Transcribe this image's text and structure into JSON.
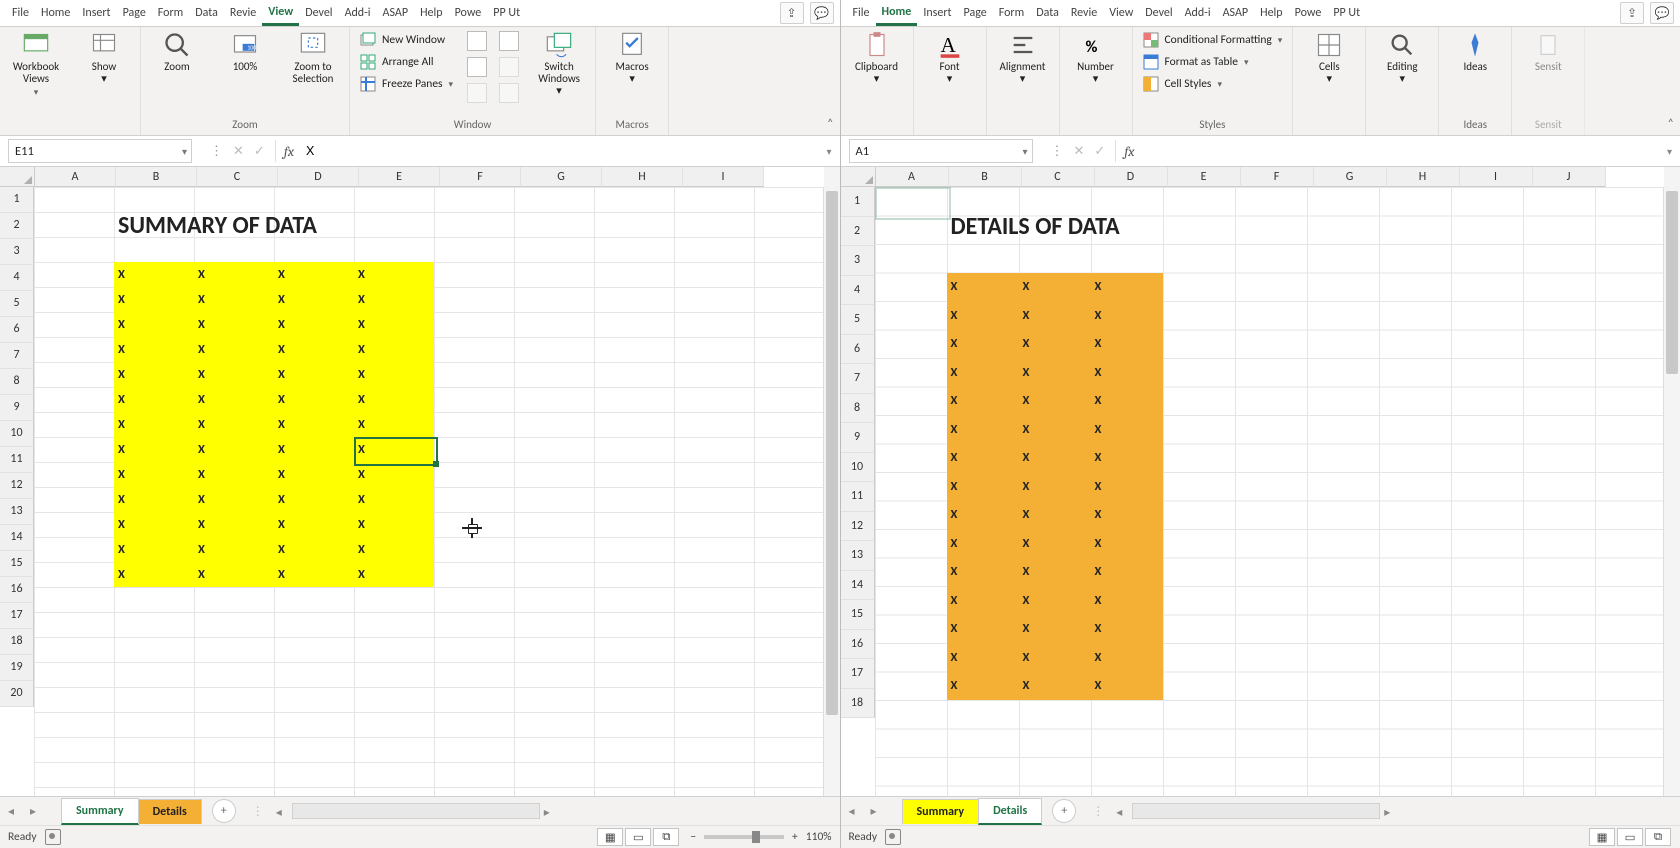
{
  "left": {
    "tabs": [
      "File",
      "Home",
      "Insert",
      "Page",
      "Form",
      "Data",
      "Revie",
      "View",
      "Devel",
      "Add-i",
      "ASAP",
      "Help",
      "Powe",
      "PP Ut"
    ],
    "active_tab": "View",
    "ribbon": {
      "workbook_views": "Workbook\nViews",
      "show": "Show",
      "zoom": "Zoom",
      "hundred": "100%",
      "zoom_sel": "Zoom to\nSelection",
      "zoom_group": "Zoom",
      "new_window": "New Window",
      "arrange_all": "Arrange All",
      "freeze_panes": "Freeze Panes",
      "switch_windows": "Switch\nWindows",
      "macros": "Macros",
      "window_group": "Window",
      "macros_group": "Macros"
    },
    "namebox": "E11",
    "formula": "X",
    "columns": [
      "A",
      "B",
      "C",
      "D",
      "E",
      "F",
      "G",
      "H",
      "I"
    ],
    "rows": [
      "1",
      "2",
      "3",
      "4",
      "5",
      "6",
      "7",
      "8",
      "9",
      "10",
      "11",
      "12",
      "13",
      "14",
      "15",
      "16",
      "17",
      "18",
      "19",
      "20"
    ],
    "title": "SUMMARY OF DATA",
    "cell_value": "X",
    "data_rows": [
      4,
      5,
      6,
      7,
      8,
      9,
      10,
      11,
      12,
      13,
      14,
      15,
      16
    ],
    "data_cols": [
      1,
      2,
      3,
      4
    ],
    "selected": {
      "col": 5,
      "row": 11
    },
    "sheet_tabs": {
      "summary": "Summary",
      "details": "Details"
    },
    "status": "Ready",
    "zoom_pct": "110%"
  },
  "right": {
    "tabs": [
      "File",
      "Home",
      "Insert",
      "Page",
      "Form",
      "Data",
      "Revie",
      "View",
      "Devel",
      "Add-i",
      "ASAP",
      "Help",
      "Powe",
      "PP Ut"
    ],
    "active_tab": "Home",
    "ribbon": {
      "clipboard": "Clipboard",
      "font": "Font",
      "alignment": "Alignment",
      "number": "Number",
      "cond_fmt": "Conditional Formatting",
      "fmt_table": "Format as Table",
      "cell_styles": "Cell Styles",
      "styles_group": "Styles",
      "cells": "Cells",
      "editing": "Editing",
      "ideas": "Ideas",
      "ideas_group": "Ideas",
      "sens": "Sensit",
      "sens_group": "Sensit"
    },
    "namebox": "A1",
    "formula": "",
    "columns": [
      "A",
      "B",
      "C",
      "D",
      "E",
      "F",
      "G",
      "H",
      "I",
      "J"
    ],
    "rows": [
      "1",
      "2",
      "3",
      "4",
      "5",
      "6",
      "7",
      "8",
      "9",
      "10",
      "11",
      "12",
      "13",
      "14",
      "15",
      "16",
      "17",
      "18"
    ],
    "title": "DETAILS OF DATA",
    "cell_value": "X",
    "data_rows": [
      4,
      5,
      6,
      7,
      8,
      9,
      10,
      11,
      12,
      13,
      14,
      15,
      16,
      17,
      18
    ],
    "data_cols": [
      1,
      2,
      3
    ],
    "selected": {
      "col": 1,
      "row": 1
    },
    "sheet_tabs": {
      "summary": "Summary",
      "details": "Details"
    },
    "status": "Ready"
  }
}
